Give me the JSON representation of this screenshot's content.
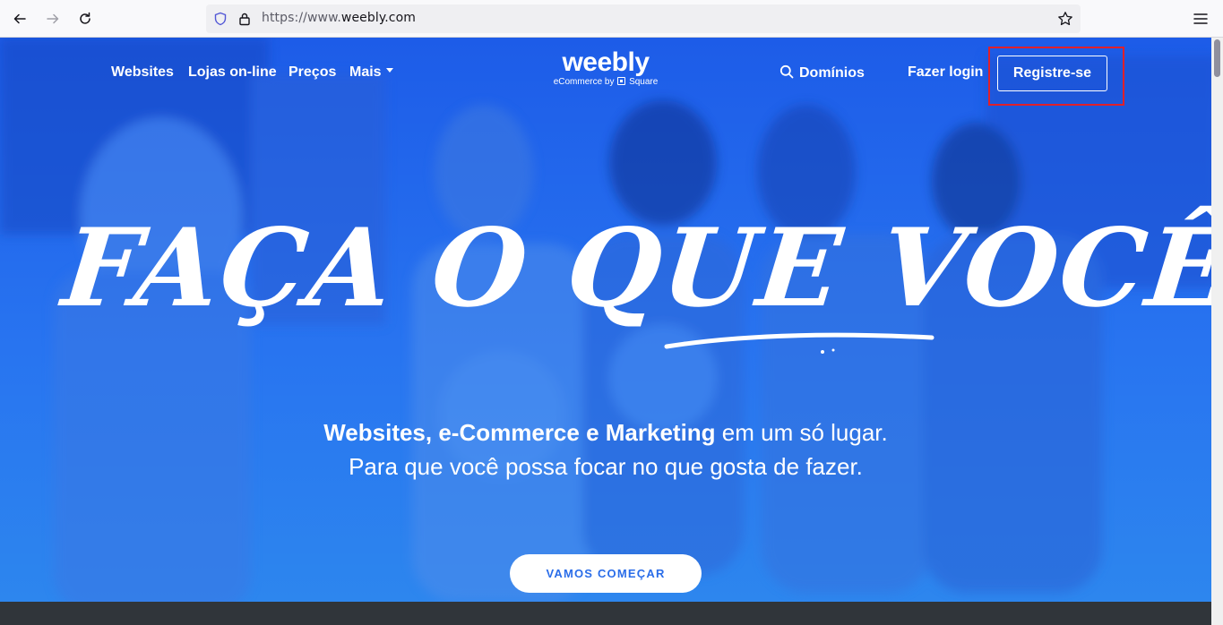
{
  "browser": {
    "url_prefix": "https://www.",
    "url_domain": "weebly.com",
    "back_icon": "arrow-left-icon",
    "forward_icon": "arrow-right-icon",
    "reload_icon": "reload-icon",
    "shield_icon": "tracking-shield-icon",
    "lock_icon": "lock-icon",
    "bookmark_icon": "star-icon",
    "menu_icon": "hamburger-menu-icon"
  },
  "site_nav": {
    "items": [
      {
        "label": "Websites"
      },
      {
        "label": "Lojas on-line"
      },
      {
        "label": "Preços"
      },
      {
        "label": "Mais"
      }
    ],
    "logo": {
      "word": "weebly",
      "sub_prefix": "eCommerce by",
      "sub_brand": "Square"
    },
    "domains_label": "Domínios",
    "login_label": "Fazer login",
    "register_label": "Registre-se"
  },
  "hero": {
    "headline": "FAÇA O QUE VOCÊ AMA",
    "subtitle_bold": "Websites, e-Commerce e Marketing",
    "subtitle_rest": " em um só lugar. Para que você possa focar no que gosta de fazer.",
    "cta_label": "VAMOS COMEÇAR"
  },
  "colors": {
    "hero_top": "#1d5ce8",
    "hero_bottom": "#2d86ee",
    "cta_text": "#2a6de9",
    "highlight": "#e0202a",
    "footer": "#30353a"
  }
}
